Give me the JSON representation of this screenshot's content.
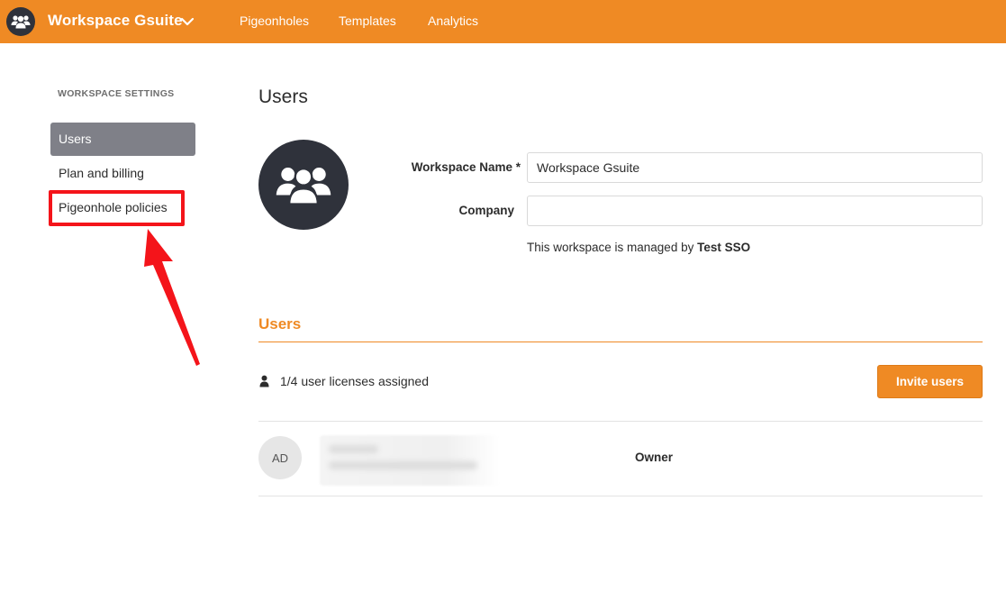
{
  "header": {
    "workspace_name": "Workspace Gsuite",
    "nav": [
      "Pigeonholes",
      "Templates",
      "Analytics"
    ],
    "accent_color": "#ef8a24"
  },
  "sidebar": {
    "heading": "WORKSPACE SETTINGS",
    "items": [
      {
        "label": "Users",
        "active": true
      },
      {
        "label": "Plan and billing",
        "active": false
      },
      {
        "label": "Pigeonhole policies",
        "active": false
      }
    ]
  },
  "main": {
    "title": "Users",
    "workspace_name_label": "Workspace Name *",
    "workspace_name_value": "Workspace Gsuite",
    "company_label": "Company",
    "company_value": "",
    "managed_prefix": "This workspace is managed by ",
    "managed_by": "Test SSO",
    "users_section_title": "Users",
    "licenses_text": "1/4 user licenses assigned",
    "invite_button": "Invite users",
    "users": [
      {
        "initials": "AD",
        "role": "Owner"
      }
    ]
  }
}
